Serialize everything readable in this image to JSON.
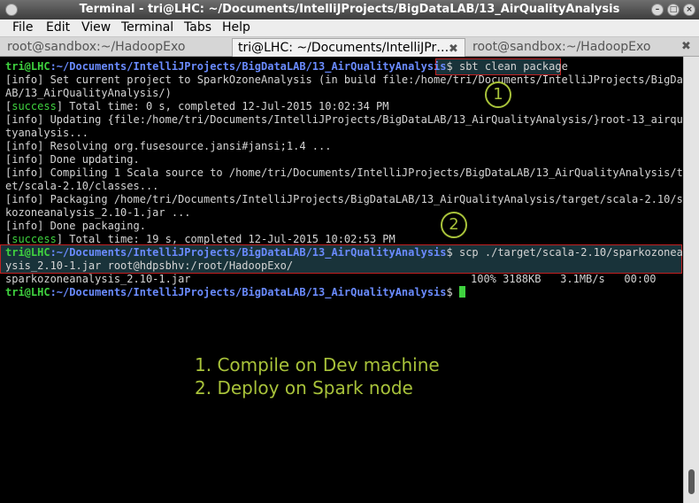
{
  "window": {
    "title": "Terminal - tri@LHC: ~/Documents/IntelliJProjects/BigDataLAB/13_AirQualityAnalysis"
  },
  "menu": [
    "File",
    "Edit",
    "View",
    "Terminal",
    "Tabs",
    "Help"
  ],
  "tabs": [
    {
      "label": "root@sandbox:~/HadoopExo",
      "active": false
    },
    {
      "label": "tri@LHC: ~/Documents/IntelliJPr…",
      "active": true
    },
    {
      "label": "root@sandbox:~/HadoopExo",
      "active": false
    }
  ],
  "terminal": {
    "prompt_user": "tri@LHC",
    "prompt_path": ":~/Documents/IntelliJProjects/BigDataLAB/13_AirQualityAnalysis",
    "prompt_symbol": "$",
    "command1": " sbt clean package",
    "lines": [
      {
        "pre": "",
        "text": "[info] Set current project to SparkOzoneAnalysis (in build file:/home/tri/Documents/IntelliJProjects/BigDataL"
      },
      {
        "pre": "",
        "text": "AB/13_AirQualityAnalysis/)"
      },
      {
        "pre": "success",
        "text": " Total time: 0 s, completed 12-Jul-2015 10:02:34 PM"
      },
      {
        "pre": "",
        "text": "[info] Updating {file:/home/tri/Documents/IntelliJProjects/BigDataLAB/13_AirQualityAnalysis/}root-13_airquali"
      },
      {
        "pre": "",
        "text": "tyanalysis..."
      },
      {
        "pre": "",
        "text": "[info] Resolving org.fusesource.jansi#jansi;1.4 ..."
      },
      {
        "pre": "",
        "text": "[info] Done updating."
      },
      {
        "pre": "",
        "text": "[info] Compiling 1 Scala source to /home/tri/Documents/IntelliJProjects/BigDataLAB/13_AirQualityAnalysis/targ"
      },
      {
        "pre": "",
        "text": "et/scala-2.10/classes..."
      },
      {
        "pre": "",
        "text": "[info] Packaging /home/tri/Documents/IntelliJProjects/BigDataLAB/13_AirQualityAnalysis/target/scala-2.10/spar"
      },
      {
        "pre": "",
        "text": "kozoneanalysis_2.10-1.jar ..."
      },
      {
        "pre": "",
        "text": "[info] Done packaging."
      },
      {
        "pre": "success",
        "text": " Total time: 19 s, completed 12-Jul-2015 10:02:53 PM"
      }
    ],
    "command2_a": " scp ./target/scala-2.10/sparkozoneanal",
    "command2_b": "ysis_2.10-1.jar root@hdpsbhv:/root/HadoopExo/",
    "transfer_file": "sparkozoneanalysis_2.10-1.jar",
    "transfer_stats": "100% 3188KB   3.1MB/s   00:00"
  },
  "annotations": {
    "marker1": "1",
    "marker2": "2",
    "caption1": "1. Compile on Dev machine",
    "caption2": "2. Deploy on Spark node"
  },
  "colors": {
    "accent": "#a8c23a",
    "prompt_user": "#3fd23f",
    "prompt_path": "#6a8bff",
    "highlight_border": "#c02020"
  }
}
